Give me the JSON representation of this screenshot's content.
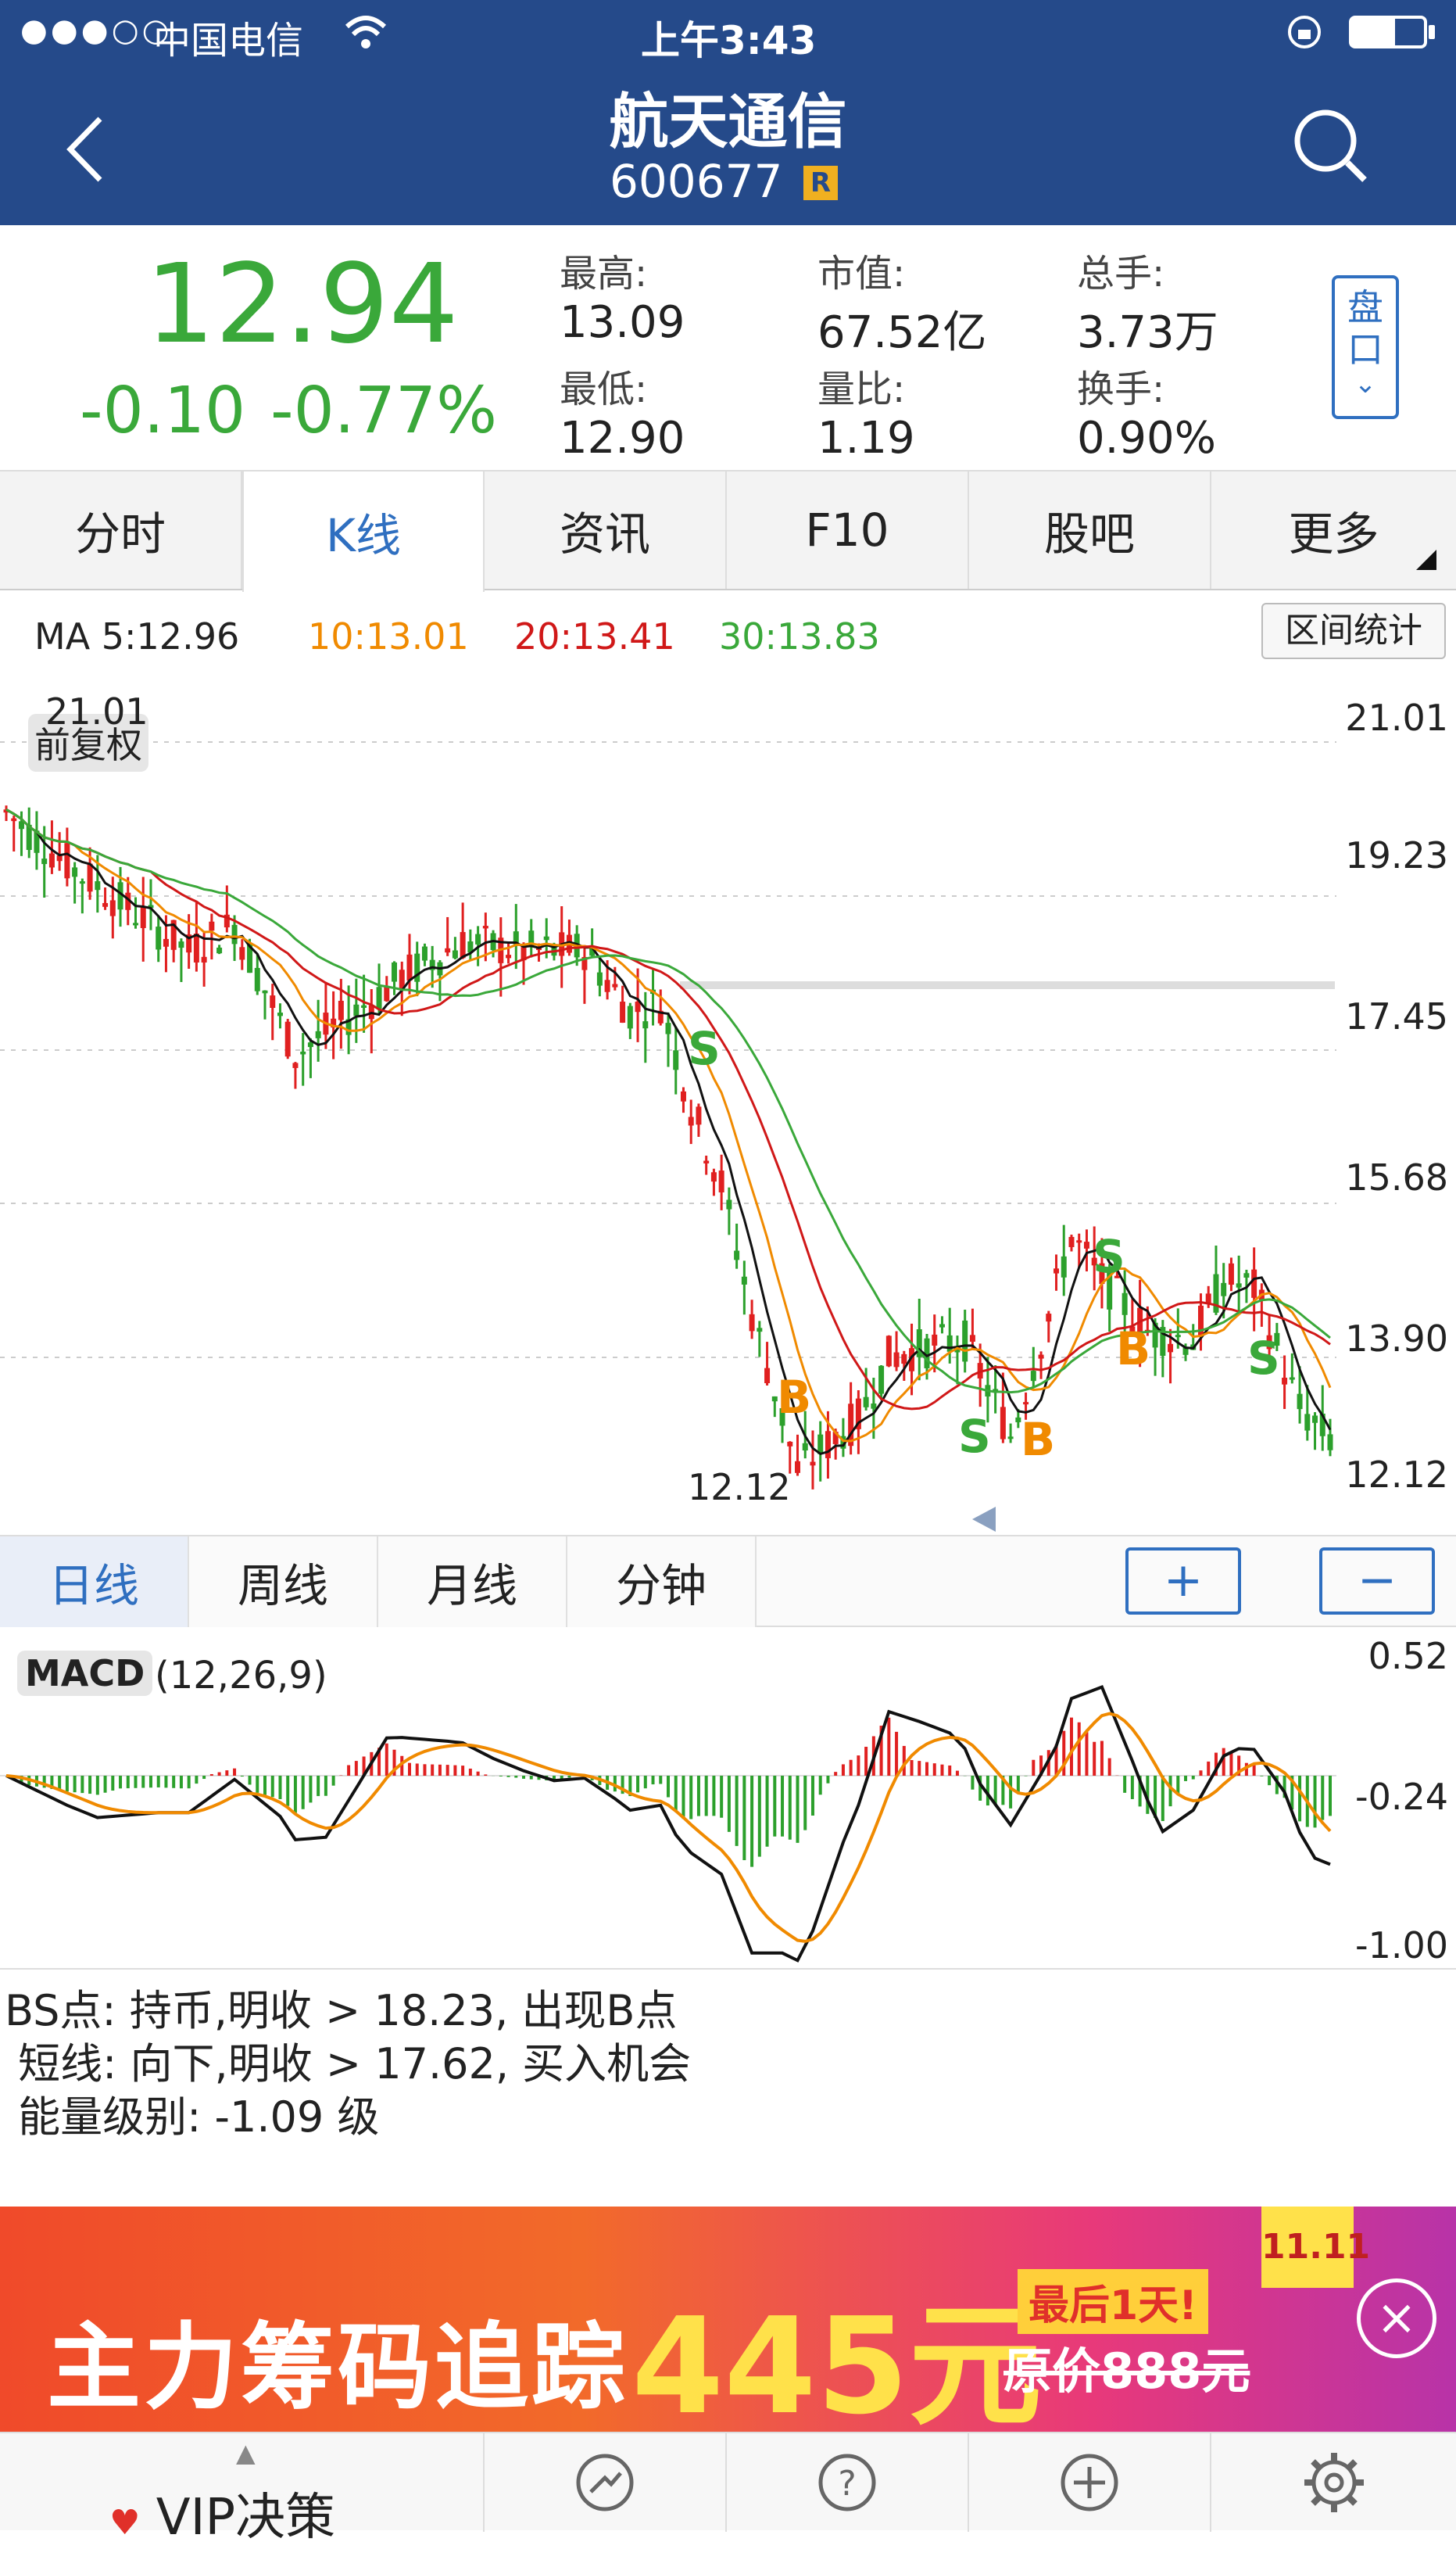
{
  "status_bar": {
    "carrier": "中国电信",
    "time": "上午3:43"
  },
  "nav": {
    "title": "航天通信",
    "code": "600677",
    "badge": "R"
  },
  "quote": {
    "price": "12.94",
    "change": "-0.10",
    "change_pct": "-0.77%",
    "stats": [
      {
        "label": "最高:",
        "value": "13.09"
      },
      {
        "label": "市值:",
        "value": "67.52亿"
      },
      {
        "label": "总手:",
        "value": "3.73万"
      },
      {
        "label": "最低:",
        "value": "12.90"
      },
      {
        "label": "量比:",
        "value": "1.19"
      },
      {
        "label": "换手:",
        "value": "0.90%"
      }
    ],
    "pankou_label": "盘口"
  },
  "tabs": [
    {
      "label": "分时"
    },
    {
      "label": "K线"
    },
    {
      "label": "资讯"
    },
    {
      "label": "F10"
    },
    {
      "label": "股吧"
    },
    {
      "label": "更多"
    }
  ],
  "ma": {
    "ma5": "MA 5:12.96",
    "ma10": "10:13.01",
    "ma20": "20:13.41",
    "ma30": "30:13.83",
    "range_btn": "区间统计"
  },
  "kline": {
    "adjust_label": "前复权",
    "high_mark": "21.01",
    "low_mark": "12.12",
    "price_axis": [
      "21.01",
      "19.23",
      "17.45",
      "15.68",
      "13.90",
      "12.12"
    ],
    "signals": [
      "S",
      "B",
      "S",
      "B",
      "S",
      "B",
      "S"
    ]
  },
  "periods": [
    {
      "label": "日线"
    },
    {
      "label": "周线"
    },
    {
      "label": "月线"
    },
    {
      "label": "分钟"
    }
  ],
  "zoom": {
    "in": "+",
    "out": "−"
  },
  "macd": {
    "label": "MACD",
    "params": "(12,26,9)",
    "axis": [
      "0.52",
      "-0.24",
      "-1.00"
    ]
  },
  "analysis": [
    "BS点: 持币,明收 > 18.23, 出现B点",
    " 短线: 向下,明收 > 17.62, 买入机会",
    " 能量级别: -1.09 级"
  ],
  "banner": {
    "text": "主力筹码追踪",
    "price": "445元",
    "last_day": "最后1天!",
    "orig_price": "原价888元",
    "tag": "11.11"
  },
  "tabbar": {
    "vip": "VIP决策"
  },
  "colors": {
    "header_bg": "#254a8a",
    "up": "#e02020",
    "down": "#2ca02c",
    "accent": "#2f6fc0",
    "ma10": "#f08a00",
    "ma20": "#d01818",
    "ma30": "#3aa83a"
  }
}
